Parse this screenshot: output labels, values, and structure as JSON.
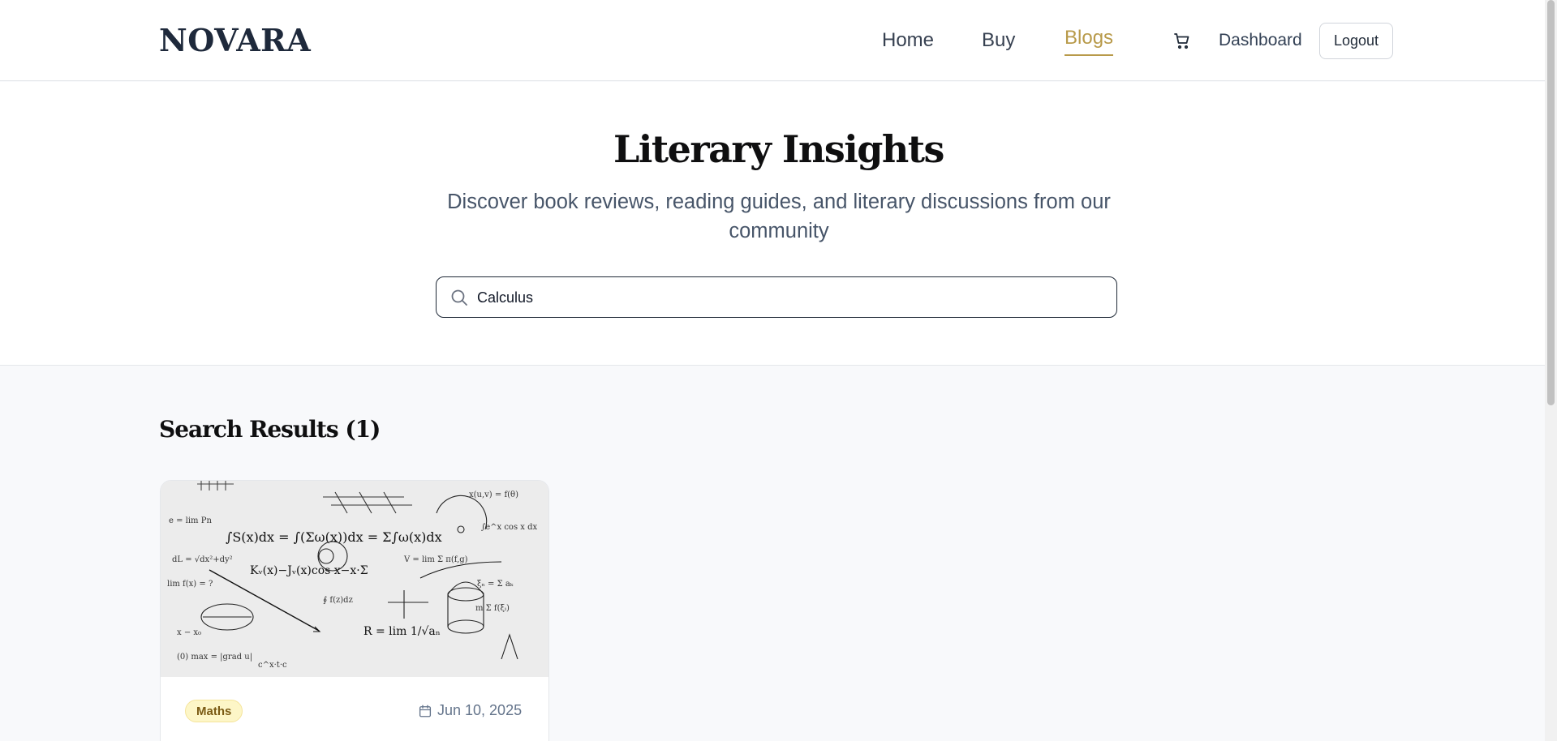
{
  "header": {
    "logo": "NOVARA",
    "nav": {
      "home": "Home",
      "buy": "Buy",
      "blogs": "Blogs"
    },
    "cart_icon": "cart-icon",
    "dashboard": "Dashboard",
    "logout": "Logout"
  },
  "hero": {
    "title": "Literary Insights",
    "subtitle": "Discover book reviews, reading guides, and literary discussions from our community",
    "search": {
      "value": "Calculus",
      "icon": "search-icon"
    }
  },
  "results": {
    "heading": "Search Results (1)",
    "posts": [
      {
        "image": "calculus-equations-image",
        "category": "Maths",
        "date": "Jun 10, 2025"
      }
    ]
  },
  "colors": {
    "accent": "#b89a4a",
    "logo": "#1e293b",
    "badge_bg": "#fdf6c7",
    "badge_text": "#7a5a13"
  }
}
